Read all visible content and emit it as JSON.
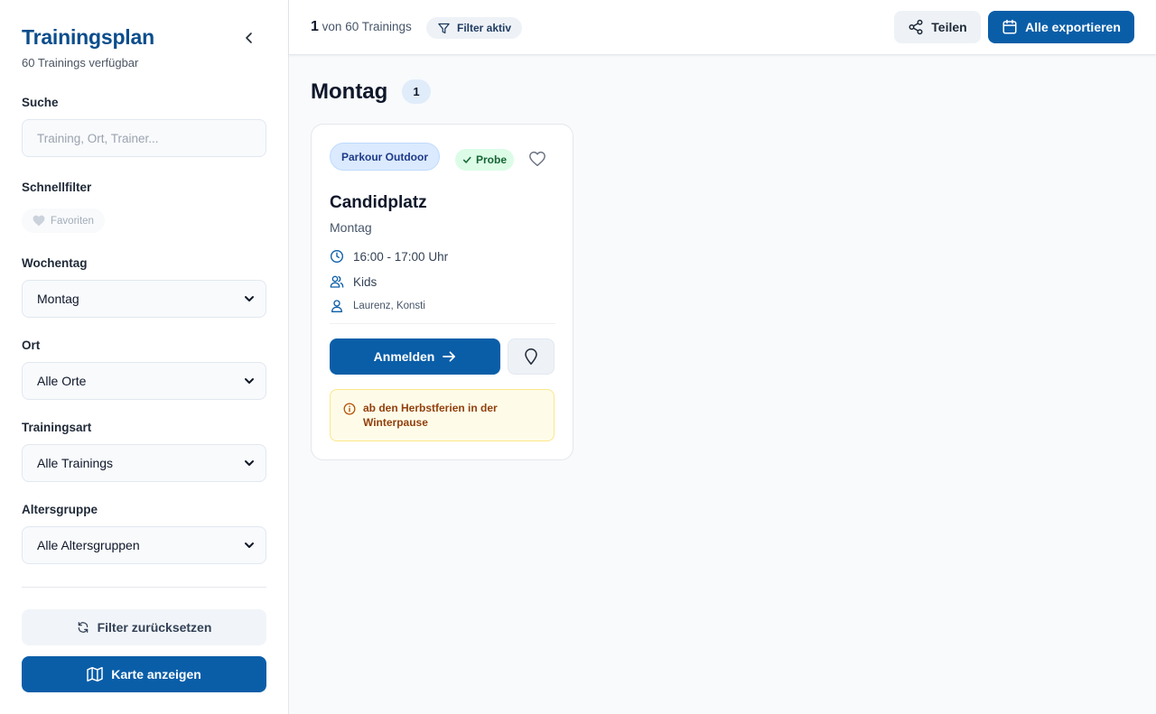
{
  "sidebar": {
    "title": "Trainingsplan",
    "subtitle": "60 Trainings verfügbar",
    "search": {
      "label": "Suche",
      "placeholder": "Training, Ort, Trainer..."
    },
    "quickfilter": {
      "label": "Schnellfilter",
      "favorites": "Favoriten"
    },
    "weekday": {
      "label": "Wochentag",
      "value": "Montag"
    },
    "location": {
      "label": "Ort",
      "value": "Alle Orte"
    },
    "type": {
      "label": "Trainingsart",
      "value": "Alle Trainings"
    },
    "agegroup": {
      "label": "Altersgruppe",
      "value": "Alle Altersgruppen"
    },
    "reset_label": "Filter zurücksetzen",
    "map_label": "Karte anzeigen"
  },
  "topbar": {
    "count_number": "1",
    "count_text": "von 60 Trainings",
    "filter_label": "Filter aktiv",
    "share_label": "Teilen",
    "export_label": "Alle exportieren"
  },
  "main": {
    "day_title": "Montag",
    "day_count": "1",
    "card": {
      "type_tag": "Parkour Outdoor",
      "probe_tag": "Probe",
      "title": "Candidplatz",
      "day": "Montag",
      "time": "16:00 - 17:00 Uhr",
      "group": "Kids",
      "trainers": "Laurenz, Konsti",
      "signup_label": "Anmelden",
      "notice": "ab den Herbstferien in der Winterpause"
    }
  },
  "colors": {
    "primary": "#0a5ea8",
    "title": "#0a4d8c",
    "probe": "#166534",
    "notice": "#92400e"
  },
  "icons": [
    "chevron-left-icon",
    "heart-icon",
    "chevron-down-icon",
    "rotate-icon",
    "map-icon",
    "filter-icon",
    "share-icon",
    "calendar-icon",
    "check-icon",
    "clock-icon",
    "users-icon",
    "user-icon",
    "arrow-right-icon",
    "map-pin-icon",
    "info-icon"
  ]
}
